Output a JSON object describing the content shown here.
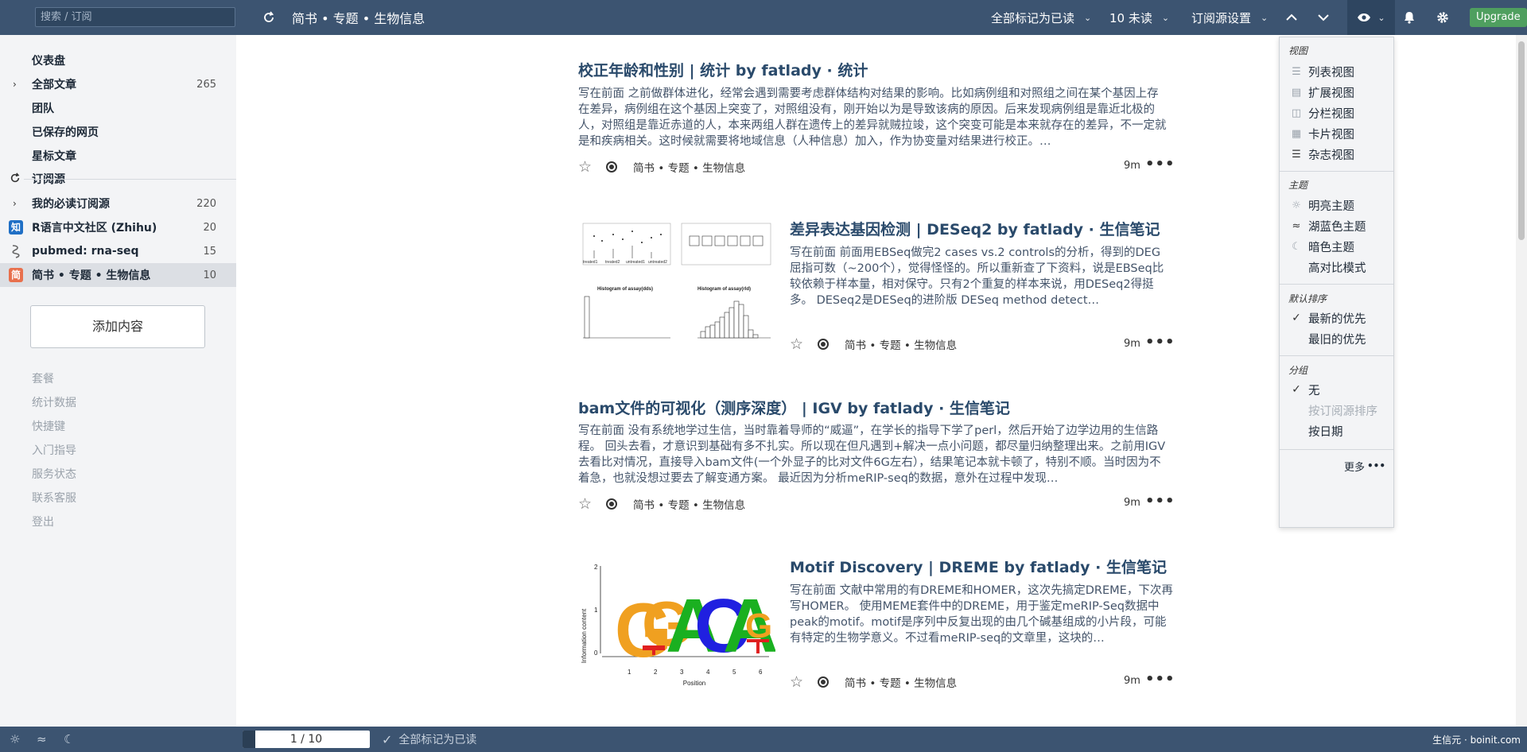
{
  "topbar": {
    "search_placeholder": "搜索 / 订阅",
    "feed_title": "简书 • 专题 • 生物信息",
    "mark_all_read": "全部标记为已读",
    "unread": "10 未读",
    "source_settings": "订阅源设置",
    "upgrade": "Upgrade"
  },
  "sidebar": {
    "dashboard": "仪表盘",
    "all_articles": {
      "label": "全部文章",
      "count": "265"
    },
    "team": "团队",
    "saved_pages": "已保存的网页",
    "starred": "星标文章",
    "subscriptions": "订阅源",
    "must_read": {
      "label": "我的必读订阅源",
      "count": "220"
    },
    "feeds": [
      {
        "label": "R语言中文社区 (Zhihu)",
        "count": "20",
        "icon_text": "知"
      },
      {
        "label": "pubmed: rna-seq",
        "count": "15"
      },
      {
        "label": "简书 • 专题 • 生物信息",
        "count": "10",
        "icon_text": "简"
      }
    ],
    "add_content": "添加内容",
    "footer": [
      "套餐",
      "统计数据",
      "快捷键",
      "入门指导",
      "服务状态",
      "联系客服",
      "登出"
    ]
  },
  "articles": [
    {
      "title": "校正年龄和性别 | 统计 by fatlady · 统计",
      "summary": "写在前面 之前做群体进化，经常会遇到需要考虑群体结构对结果的影响。比如病例组和对照组之间在某个基因上存在差异，病例组在这个基因上突变了，对照组没有，刚开始以为是导致该病的原因。后来发现病例组是靠近北极的人，对照组是靠近赤道的人，本来两组人群在遗传上的差异就贼拉竣，这个突变可能是本来就存在的差异，不一定就是和疾病相关。这时候就需要将地域信息（人种信息）加入，作为协变量对结果进行校正。…",
      "source": "简书 • 专题 • 生物信息",
      "age": "9m"
    },
    {
      "title": "差异表达基因检测 | DESeq2 by fatlady · 生信笔记",
      "summary": "写在前面 前面用EBSeq做完2 cases vs.2 controls的分析，得到的DEG屈指可数（~200个），觉得怪怪的。所以重新查了下资料，说是EBSeq比较依赖于样本量，相对保守。只有2个重复的样本来说，用DESeq2得挺多。 DESeq2是DESeq的进阶版 DESeq method detect…",
      "source": "简书 • 专题 • 生物信息",
      "age": "9m",
      "thumb": {
        "box_labels": [
          "treated1",
          "treated2",
          "untreated1",
          "untreated2"
        ],
        "hist1_title": "Histogram of assay(dds)",
        "hist2_title": "Histogram of assay(rld)"
      }
    },
    {
      "title": "bam文件的可视化（测序深度） | IGV by fatlady · 生信笔记",
      "summary": "写在前面 没有系统地学过生信，当时靠着导师的“威逼”，在学长的指导下学了perl，然后开始了边学边用的生信路程。 回头去看，才意识到基础有多不扎实。所以现在但凡遇到+解决一点小问题，都尽量归纳整理出来。之前用IGV去看比对情况，直接导入bam文件(一个外显子的比对文件6G左右），结果笔记本就卡顿了，特别不顺。当时因为不着急，也就没想过要去了解变通方案。 最近因为分析meRIP-seq的数据，意外在过程中发现…",
      "source": "简书 • 专题 • 生物信息",
      "age": "9m"
    },
    {
      "title": "Motif Discovery | DREME by fatlady · 生信笔记",
      "summary": "写在前面 文献中常用的有DREME和HOMER，这次先搞定DREME，下次再写HOMER。 使用MEME套件中的DREME，用于鉴定meRIP-Seq数据中peak的motif。motif是序列中反复出现的由几个碱基组成的小片段，可能有特定的生物学意义。不过看meRIP-seq的文章里，这块的…",
      "source": "简书 • 专题 • 生物信息",
      "age": "9m",
      "thumb": {
        "ylabel": "Information content",
        "xlabel": "Position",
        "yticks": [
          "2",
          "1",
          "0"
        ],
        "xticks": [
          "1",
          "2",
          "3",
          "4",
          "5",
          "6"
        ],
        "letters": [
          "G",
          "G",
          "A",
          "C",
          "A",
          "G"
        ]
      }
    }
  ],
  "menu": {
    "view_title": "视图",
    "views": [
      "列表视图",
      "扩展视图",
      "分栏视图",
      "卡片视图",
      "杂志视图"
    ],
    "theme_title": "主题",
    "themes": [
      "明亮主题",
      "湖蓝色主题",
      "暗色主题",
      "高对比模式"
    ],
    "sort_title": "默认排序",
    "sorts": [
      "最新的优先",
      "最旧的优先"
    ],
    "group_title": "分组",
    "groups": [
      "无",
      "按订阅源排序",
      "按日期"
    ],
    "more": "更多"
  },
  "bottombar": {
    "pager": "1 / 10",
    "mark_all_read": "全部标记为已读",
    "brand": "生信元 · boinit.com"
  },
  "colors": {
    "topbar": "#3c5471",
    "title": "#2a4a6b",
    "upgrade": "#4f9f5f",
    "feed_zhihu": "#1f6fc5",
    "feed_jianshu": "#e8704d"
  }
}
